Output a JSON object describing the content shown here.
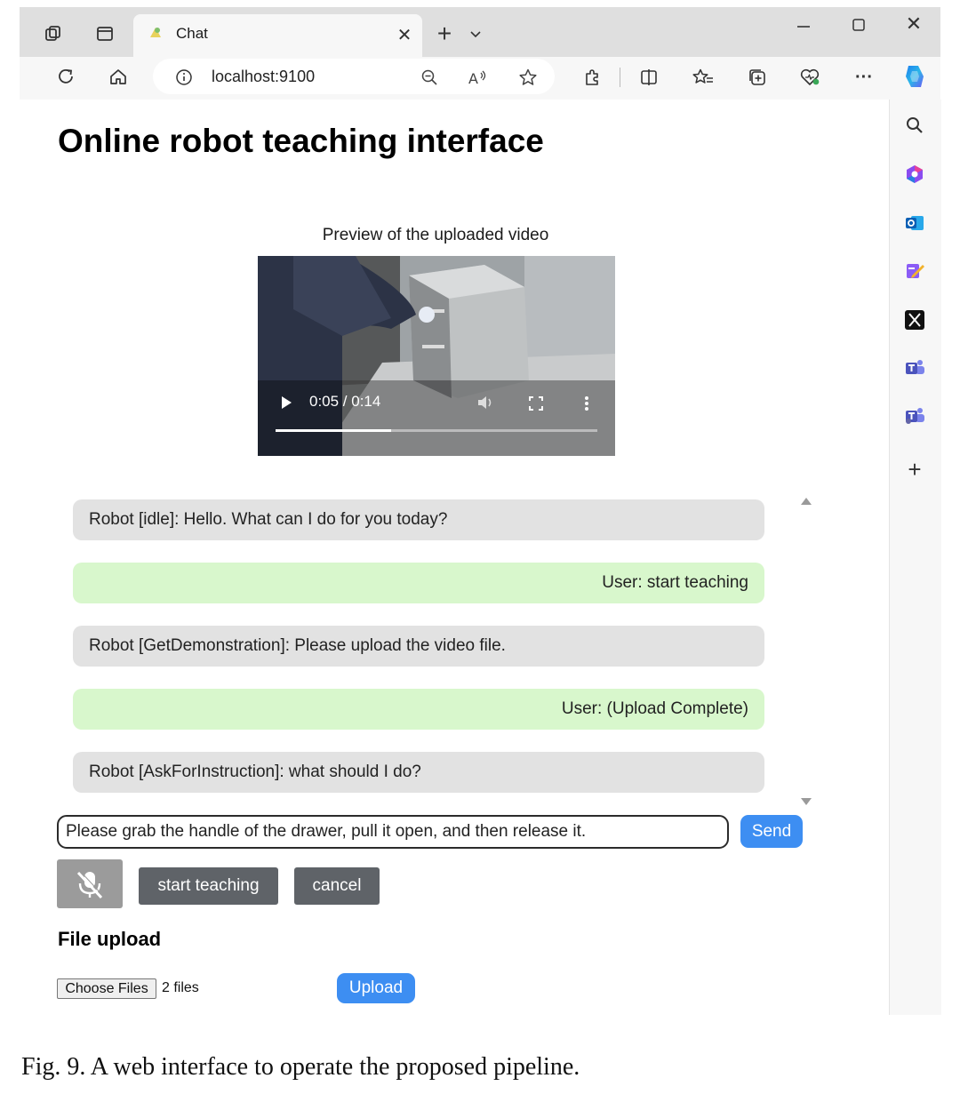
{
  "browser": {
    "tab_title": "Chat",
    "url": "localhost:9100",
    "icons": [
      "workspaces-icon",
      "tab-actions-icon",
      "close-tab-icon",
      "new-tab-icon",
      "tab-list-icon",
      "minimize-icon",
      "maximize-icon",
      "close-window-icon",
      "refresh-icon",
      "home-icon",
      "info-icon",
      "zoom-out-icon",
      "read-aloud-icon",
      "favorite-star-icon",
      "extensions-icon",
      "split-screen-icon",
      "favorites-icon",
      "collections-icon",
      "browser-essentials-icon",
      "more-icon",
      "copilot-icon"
    ],
    "sidebar_icons": [
      "search-icon",
      "copilot-app-icon",
      "outlook-icon",
      "designer-icon",
      "x-icon",
      "teams-icon",
      "teams-alt-icon",
      "add-icon"
    ]
  },
  "page": {
    "title": "Online robot teaching interface",
    "video_caption": "Preview of the uploaded video",
    "video": {
      "time": "0:05 / 0:14",
      "progress": 0.36
    }
  },
  "chat": {
    "messages": [
      {
        "role": "bot",
        "text": "Robot [idle]: Hello. What can I do for you today?"
      },
      {
        "role": "user",
        "text": "User: start teaching"
      },
      {
        "role": "bot",
        "text": "Robot [GetDemonstration]: Please upload the video file."
      },
      {
        "role": "user",
        "text": "User: (Upload Complete)"
      },
      {
        "role": "bot",
        "text": "Robot [AskForInstruction]: what should I do?"
      }
    ],
    "input_value": "Please grab the handle of the drawer, pull it open, and then release it.",
    "send_label": "Send",
    "start_teaching_label": "start teaching",
    "cancel_label": "cancel"
  },
  "upload": {
    "heading": "File upload",
    "choose_label": "Choose Files",
    "file_count": "2 files",
    "upload_label": "Upload"
  },
  "figure_caption": "Fig. 9.  A web interface to operate the proposed pipeline.",
  "colors": {
    "bot_bubble": "#e2e2e2",
    "user_bubble": "#d8f7cc",
    "accent_blue": "#3d8ef2",
    "dark_button": "#5f6368"
  }
}
